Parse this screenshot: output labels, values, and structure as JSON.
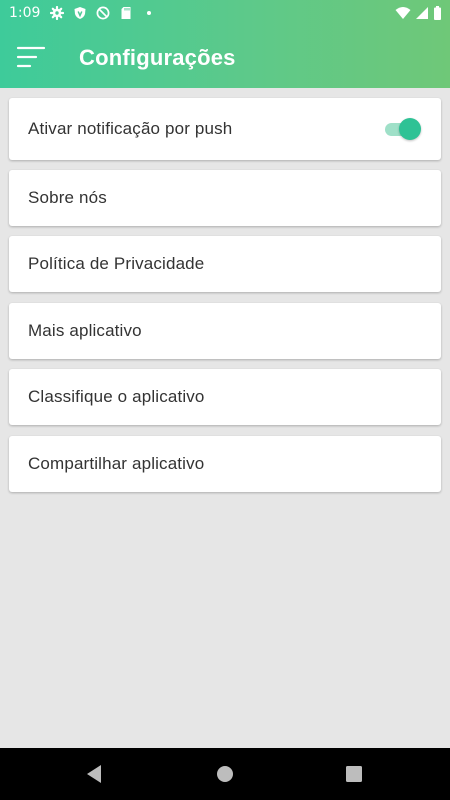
{
  "status_bar": {
    "time": "1:09",
    "left_icons": [
      "gear-icon",
      "shield-icon",
      "no-sync-icon",
      "sd-card-icon",
      "dot-icon"
    ],
    "right_icons": [
      "wifi-icon",
      "signal-icon",
      "battery-icon"
    ]
  },
  "toolbar": {
    "title": "Configurações",
    "menu_icon": "menu-icon"
  },
  "colors": {
    "header_gradient_start": "#3ecb9a",
    "header_gradient_end": "#6fc878",
    "toggle_track": "#9fe0c8",
    "toggle_thumb": "#2ec295",
    "background": "#e6e6e6",
    "card": "#ffffff",
    "text": "#333333"
  },
  "settings": {
    "items": [
      {
        "label": "Ativar notificação por push",
        "toggle": true,
        "toggle_on": true
      },
      {
        "label": "Sobre nós"
      },
      {
        "label": "Política de Privacidade"
      },
      {
        "label": "Mais aplicativo"
      },
      {
        "label": "Classifique o aplicativo"
      },
      {
        "label": "Compartilhar aplicativo"
      }
    ]
  },
  "nav_bar": {
    "icons": [
      "back-icon",
      "home-icon",
      "recents-icon"
    ]
  }
}
